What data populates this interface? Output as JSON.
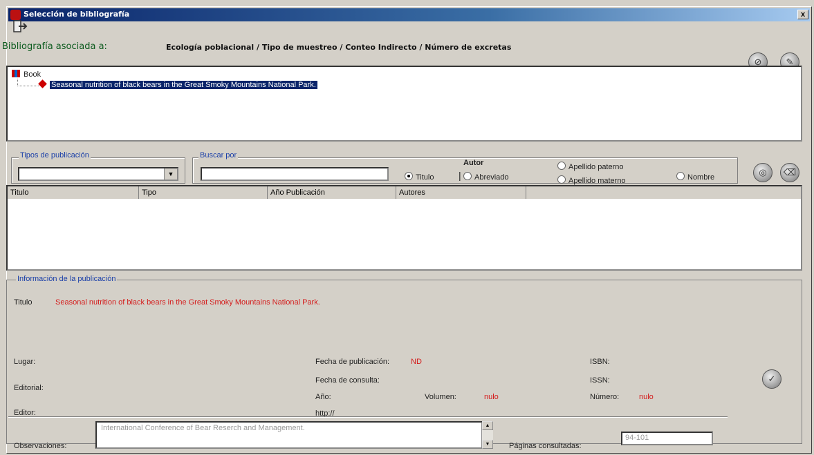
{
  "window": {
    "title": "Selección de bibliografía",
    "close_label": "x"
  },
  "header": {
    "assoc_label": "Bibliografía asociada a:",
    "assoc_value": "Ecología poblacional / Tipo de muestreo / Conteo Indirecto / Número de excretas"
  },
  "tree": {
    "root_label": "Book",
    "selected_item": "Seasonal nutrition of black bears in the Great Smoky Mountains National Park."
  },
  "filters": {
    "publication_types_label": "Tipos de publicación",
    "search_by_label": "Buscar por",
    "search_value": "",
    "author_label": "Autor",
    "radio_titulo": "Titulo",
    "radio_abreviado": "Abreviado",
    "radio_apellido_paterno": "Apellido paterno",
    "radio_apellido_materno": "Apellido materno",
    "radio_nombre": "Nombre",
    "selected_radio": "Titulo"
  },
  "results": {
    "columns": [
      "Titulo",
      "Tipo",
      "Año Publicación",
      "Autores"
    ],
    "rows": []
  },
  "info": {
    "section_label": "Información de la publicación",
    "titulo_label": "Titulo",
    "titulo_value": "Seasonal nutrition of black bears in the Great Smoky Mountains National Park.",
    "lugar_label": "Lugar:",
    "editorial_label": "Editorial:",
    "editor_label": "Editor:",
    "fecha_pub_label": "Fecha de publicación:",
    "fecha_pub_value": "ND",
    "fecha_consulta_label": "Fecha de consulta:",
    "anio_label": "Año:",
    "volumen_label": "Volumen:",
    "volumen_value": "nulo",
    "http_label": "http://",
    "isbn_label": "ISBN:",
    "issn_label": "ISSN:",
    "numero_label": "Número:",
    "numero_value": "nulo",
    "observaciones_label": "Observaciones:",
    "observaciones_value": "International Conference of Bear Reserch and Management.",
    "paginas_label": "Páginas consultadas:",
    "paginas_value": "94-101"
  }
}
